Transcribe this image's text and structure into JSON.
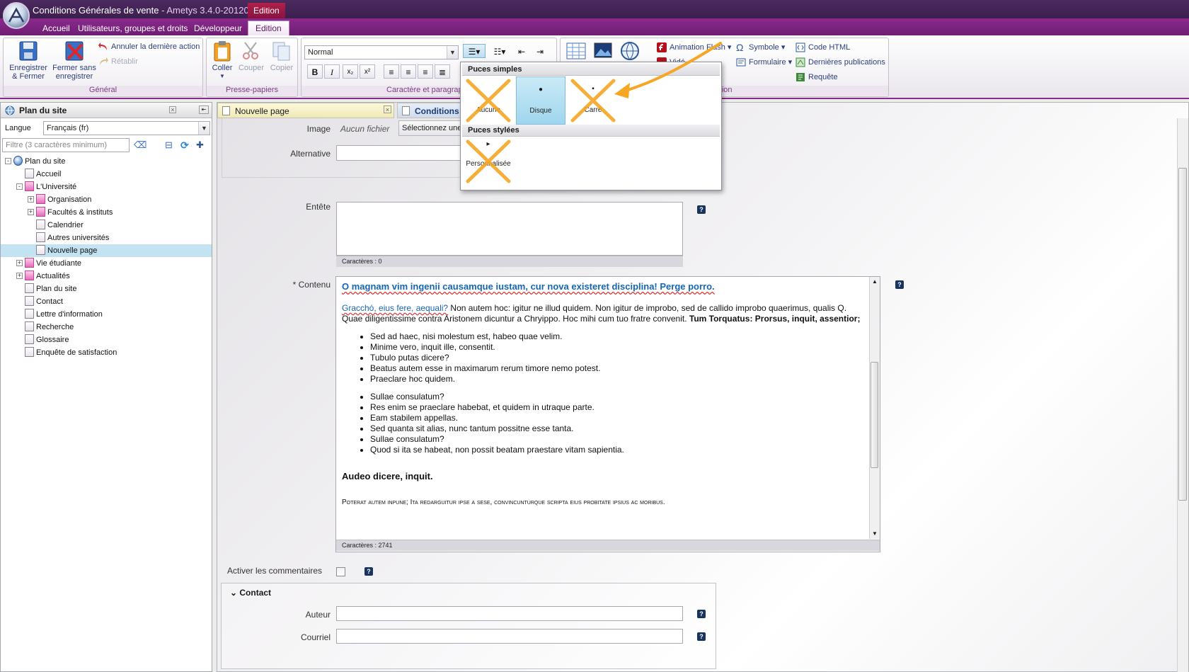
{
  "window": {
    "title": "Conditions Générales de vente",
    "title_suffix": " - Ametys 3.4.0-201204(",
    "context_tab": "Edition"
  },
  "ribbon_tabs": [
    "Accueil",
    "Utilisateurs, groupes et droits",
    "Développeur",
    "Edition"
  ],
  "groups": {
    "general": {
      "label": "Général",
      "save_close": "Enregistrer",
      "save_close_2": "& Fermer",
      "close_nosave": "Fermer sans",
      "close_nosave_2": "enregistrer",
      "undo": "Annuler la dernière action",
      "redo": "Rétablir"
    },
    "clipboard": {
      "label": "Presse-papiers",
      "paste": "Coller",
      "cut": "Couper",
      "copy": "Copier"
    },
    "character": {
      "label": "Caractère et paragrap",
      "style_value": "Normal",
      "bold": "B",
      "italic": "I",
      "subscript": "x₂",
      "superscript": "x²"
    },
    "insertion": {
      "label": "ertion",
      "flash": "Animation Flash",
      "video_partial": "Vidé",
      "symbol": "Symbole",
      "form": "Formulaire",
      "html_code": "Code HTML",
      "last_pubs": "Dernières publications",
      "query": "Requête"
    }
  },
  "bullet_menu": {
    "simple_header": "Puces simples",
    "styled_header": "Puces stylées",
    "items": [
      {
        "label": "Aucune",
        "glyph": ""
      },
      {
        "label": "Disque",
        "glyph": "●"
      },
      {
        "label": "Carré",
        "glyph": "▪"
      },
      {
        "label": "Personnalisée",
        "glyph": "▸"
      }
    ]
  },
  "sitemap": {
    "header": "Plan du site",
    "language_label": "Langue",
    "language_value": "Français (fr)",
    "filter_placeholder": "Filtre (3 caractères minimum)",
    "tree": [
      {
        "label": "Plan du site",
        "level": 0,
        "icon": "globe",
        "expander": "-"
      },
      {
        "label": "Accueil",
        "level": 1,
        "icon": "page"
      },
      {
        "label": "L'Université",
        "level": 1,
        "icon": "pink",
        "expander": "-"
      },
      {
        "label": "Organisation",
        "level": 2,
        "icon": "pink",
        "expander": "+"
      },
      {
        "label": "Facultés & instituts",
        "level": 2,
        "icon": "pink",
        "expander": "+"
      },
      {
        "label": "Calendrier",
        "level": 2,
        "icon": "page"
      },
      {
        "label": "Autres universités",
        "level": 2,
        "icon": "page"
      },
      {
        "label": "Nouvelle page",
        "level": 2,
        "icon": "page",
        "selected": true
      },
      {
        "label": "Vie étudiante",
        "level": 1,
        "icon": "pink",
        "expander": "+"
      },
      {
        "label": "Actualités",
        "level": 1,
        "icon": "pink",
        "expander": "+"
      },
      {
        "label": "Plan du site",
        "level": 1,
        "icon": "page"
      },
      {
        "label": "Contact",
        "level": 1,
        "icon": "page"
      },
      {
        "label": "Lettre d'information",
        "level": 1,
        "icon": "page"
      },
      {
        "label": "Recherche",
        "level": 1,
        "icon": "page"
      },
      {
        "label": "Glossaire",
        "level": 1,
        "icon": "page"
      },
      {
        "label": "Enquête de satisfaction",
        "level": 1,
        "icon": "page"
      }
    ]
  },
  "doc_tabs": [
    {
      "label": "Nouvelle page"
    },
    {
      "label": "Conditions G"
    }
  ],
  "form": {
    "image_label": "Image",
    "image_value": "Aucun fichier",
    "image_select": "Sélectionnez une",
    "alternative_label": "Alternative",
    "header_label": "Entête",
    "header_chars": "Caractères : 0",
    "content_label": "* Contenu",
    "content_chars": "Caractères : 2741",
    "comments_label": "Activer les commentaires",
    "contact_section": "Contact",
    "author_label": "Auteur",
    "email_label": "Courriel",
    "help": "?"
  },
  "content": {
    "heading": "O magnam vim ingenii causamque iustam, cur nova existeret disciplina! Perge porro.",
    "para_link": "Gracchó, eius fere, aequali?",
    "para_text": " Non autem hoc: igitur ne illud quidem. Non igitur de improbo, sed de callido improbo quaerimus, qualis Q. Quae diligentissime contra Aristonem dicuntur a Chryippo. Hoc mihi cum tuo fratre convenit. ",
    "para_bold": "Tum Torquatus: Prorsus, inquit, assentior;",
    "list1": [
      "Sed ad haec, nisi molestum est, habeo quae velim.",
      "Minime vero, inquit ille, consentit.",
      "Tubulo putas dicere?",
      "Beatus autem esse in maximarum rerum timore nemo potest.",
      "Praeclare hoc quidem."
    ],
    "list2": [
      "Sullae consulatum?",
      "Res enim se praeclare habebat, et quidem in utraque parte.",
      "Eam stabilem appellas.",
      "Sed quanta sit alias, nunc tantum possitne esse tanta.",
      "Sullae consulatum?",
      "Quod si ita se habeat, non possit beatam praestare vitam sapientia."
    ],
    "subheading": "Audeo dicere, inquit.",
    "smallcaps": "Poterat autem inpune; Ita redarguitur ipse a sese, convincunturque scripta eius probitate ipsius ac moribus."
  },
  "colors": {
    "brand_purple": "#8a2a8c",
    "link_blue": "#1565b5",
    "highlight_orange": "#f5a623",
    "selected_row": "#c3e3f3"
  }
}
